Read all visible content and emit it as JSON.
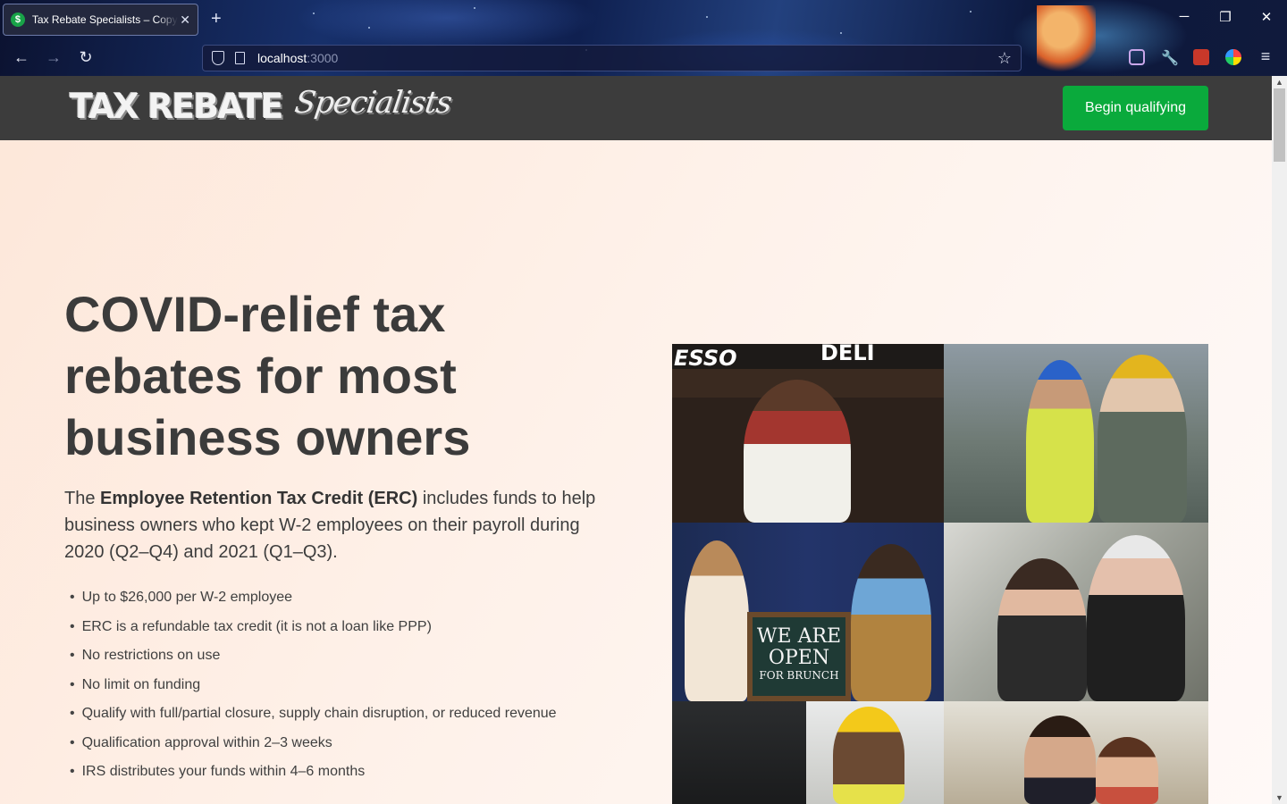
{
  "browser": {
    "tab_title": "Tax Rebate Specialists – Copyright",
    "favicon_glyph": "$",
    "new_tab_glyph": "+",
    "tab_close_glyph": "✕",
    "url_host": "localhost",
    "url_port": ":3000",
    "back_glyph": "←",
    "forward_glyph": "→",
    "reload_glyph": "↻",
    "bookmark_glyph": "☆",
    "minimize_glyph": "─",
    "restore_glyph": "❐",
    "close_glyph": "✕",
    "menu_glyph": "≡"
  },
  "header": {
    "logo_main": "TAX REBATE",
    "logo_script": "Specialists",
    "cta_label": "Begin qualifying",
    "cta_color": "#0aaa3c"
  },
  "hero": {
    "title": "COVID-relief tax rebates for most business owners",
    "lead_prefix": "The ",
    "lead_bold": "Employee Retention Tax Credit (ERC)",
    "lead_suffix": " includes funds to help business owners who kept W-2 employees on their payroll during 2020 (Q2–Q4) and 2021 (Q1–Q3).",
    "bullets": [
      "Up to $26,000 per W-2 employee",
      "ERC is a refundable tax credit (it is not a loan like PPP)",
      "No restrictions on use",
      "No limit on funding",
      "Qualify with full/partial closure, supply chain disruption, or reduced revenue",
      "Qualification approval within 2–3 weeks",
      "IRS distributes your funds within 4–6 months"
    ]
  },
  "photos": {
    "sign_espresso": "ESSO",
    "sign_deli": "DELI",
    "board_line1": "WE ARE",
    "board_line2": "OPEN",
    "board_line3": "FOR BRUNCH"
  },
  "scrollbar": {
    "up_glyph": "▲",
    "down_glyph": "▼"
  }
}
